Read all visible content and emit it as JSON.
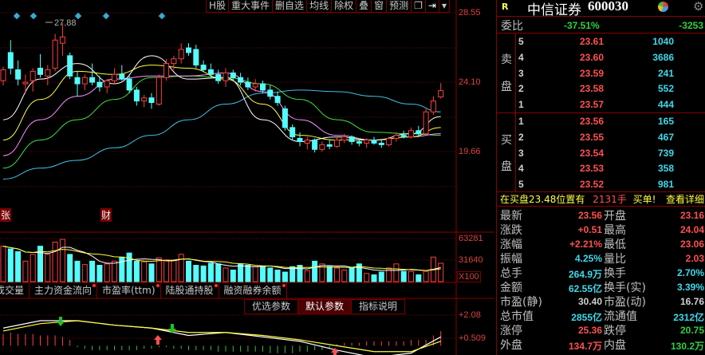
{
  "toolbar": {
    "items": [
      "H股",
      "重大事件",
      "删自选",
      "均线",
      "除权",
      "叠",
      "窗",
      "预测"
    ],
    "icons": [
      "window-icon",
      "export-icon",
      "dropdown-icon"
    ]
  },
  "price_axis": {
    "top": "28.55",
    "mid": "24.10",
    "low": "19.66"
  },
  "annotations": {
    "high_label": "27.88",
    "marker_zhang": "张",
    "marker_cai": "财"
  },
  "volume_axis": {
    "top": "63281",
    "mid": "31640",
    "unit": "X100"
  },
  "indicator_tabs": [
    {
      "label": "成交量"
    },
    {
      "label": "主力资金流向"
    },
    {
      "label": "市盈率(ttm)"
    },
    {
      "label": "陆股通持股"
    },
    {
      "label": "融资融券余额"
    }
  ],
  "param_buttons": {
    "optimized": "优选参数",
    "default": "默认参数",
    "explain": "指标说明"
  },
  "macd_axis": {
    "top": "+2.08",
    "mid": "+0.509"
  },
  "colors": {
    "up": "#ff4040",
    "down": "#54fcfc",
    "ma5": "#ffffff",
    "ma10": "#ffff40",
    "ma20": "#ff90ff",
    "ma30": "#40e040",
    "ma60": "#40c0e0"
  },
  "chart_data": {
    "type": "candlestick",
    "price_range": [
      19.66,
      28.55
    ],
    "candles": [
      [
        24.2,
        25.1,
        23.9,
        24.9
      ],
      [
        26.0,
        26.8,
        24.6,
        25.0
      ],
      [
        24.9,
        25.5,
        23.9,
        24.3
      ],
      [
        24.0,
        24.6,
        23.4,
        24.1
      ],
      [
        24.2,
        25.0,
        23.5,
        24.8
      ],
      [
        25.0,
        25.9,
        24.4,
        24.6
      ],
      [
        24.5,
        25.2,
        23.9,
        24.9
      ],
      [
        25.0,
        27.2,
        24.8,
        26.8
      ],
      [
        26.6,
        27.88,
        25.8,
        27.0
      ],
      [
        25.8,
        26.0,
        24.3,
        24.5
      ],
      [
        24.4,
        24.8,
        23.2,
        24.0
      ],
      [
        24.0,
        24.6,
        23.6,
        24.4
      ],
      [
        24.4,
        25.3,
        23.9,
        24.1
      ],
      [
        24.1,
        24.5,
        23.5,
        23.8
      ],
      [
        23.8,
        24.3,
        23.4,
        24.2
      ],
      [
        24.2,
        25.0,
        24.0,
        24.6
      ],
      [
        24.6,
        25.2,
        24.2,
        24.3
      ],
      [
        24.3,
        24.6,
        23.4,
        23.6
      ],
      [
        23.6,
        23.8,
        22.6,
        22.9
      ],
      [
        22.9,
        23.3,
        22.5,
        23.1
      ],
      [
        23.1,
        23.4,
        22.4,
        22.8
      ],
      [
        22.7,
        24.6,
        22.6,
        24.4
      ],
      [
        24.4,
        25.6,
        24.2,
        25.3
      ],
      [
        25.3,
        25.8,
        24.9,
        25.6
      ],
      [
        25.6,
        26.6,
        25.3,
        26.2
      ],
      [
        26.3,
        26.6,
        25.8,
        26.0
      ],
      [
        26.2,
        26.5,
        25.0,
        25.2
      ],
      [
        25.2,
        25.5,
        24.8,
        24.9
      ],
      [
        24.9,
        25.3,
        24.4,
        24.6
      ],
      [
        24.6,
        24.9,
        24.0,
        24.2
      ],
      [
        24.2,
        25.0,
        23.8,
        24.7
      ],
      [
        24.7,
        24.9,
        24.2,
        24.4
      ],
      [
        24.4,
        24.7,
        23.9,
        24.1
      ],
      [
        24.1,
        24.4,
        23.6,
        23.8
      ],
      [
        23.8,
        24.3,
        23.5,
        24.0
      ],
      [
        24.0,
        24.2,
        23.4,
        23.6
      ],
      [
        23.6,
        23.9,
        23.0,
        23.2
      ],
      [
        23.2,
        23.5,
        22.6,
        22.8
      ],
      [
        22.4,
        22.6,
        21.0,
        21.2
      ],
      [
        21.2,
        21.4,
        20.4,
        20.6
      ],
      [
        20.5,
        20.9,
        20.0,
        20.3
      ],
      [
        20.2,
        20.6,
        19.8,
        20.4
      ],
      [
        20.4,
        20.5,
        19.6,
        19.8
      ],
      [
        19.8,
        20.3,
        19.66,
        20.1
      ],
      [
        20.1,
        20.4,
        19.8,
        20.0
      ],
      [
        20.0,
        20.6,
        19.9,
        20.4
      ],
      [
        20.4,
        20.8,
        20.2,
        20.6
      ],
      [
        20.6,
        20.7,
        20.1,
        20.3
      ],
      [
        20.3,
        20.5,
        20.0,
        20.2
      ],
      [
        20.2,
        20.5,
        19.9,
        20.4
      ],
      [
        20.4,
        20.6,
        20.1,
        20.2
      ],
      [
        20.2,
        20.4,
        19.9,
        20.1
      ],
      [
        20.1,
        20.6,
        20.0,
        20.5
      ],
      [
        20.5,
        20.9,
        20.3,
        20.7
      ],
      [
        20.7,
        21.0,
        20.5,
        20.6
      ],
      [
        20.6,
        21.2,
        20.5,
        21.0
      ],
      [
        21.0,
        21.3,
        20.6,
        20.8
      ],
      [
        20.8,
        22.4,
        20.7,
        22.2
      ],
      [
        22.2,
        23.2,
        22.0,
        22.9
      ],
      [
        23.16,
        24.04,
        23.06,
        23.56
      ]
    ],
    "ma_sample_every": 5,
    "ma": {
      "ma5": [
        21.7,
        24.3,
        25.3,
        24.0,
        25.8,
        24.3,
        24.4,
        21.7,
        20.3,
        20.6,
        20.4,
        20.8,
        21.9
      ],
      "ma10": [
        20.4,
        23.0,
        24.8,
        24.6,
        25.2,
        25.0,
        24.3,
        22.7,
        20.7,
        20.4,
        20.4,
        20.6,
        21.2
      ],
      "ma20": [
        19.4,
        21.7,
        23.2,
        24.3,
        24.5,
        24.5,
        24.7,
        23.5,
        21.7,
        20.7,
        20.4,
        20.6,
        20.8
      ],
      "ma30": [
        18.6,
        20.4,
        21.7,
        23.0,
        24.4,
        24.5,
        24.4,
        24.0,
        23.0,
        21.7,
        20.9,
        20.8,
        20.7
      ],
      "ma60": [
        17.9,
        18.6,
        19.1,
        19.9,
        20.7,
        21.7,
        22.7,
        23.4,
        23.6,
        23.5,
        23.2,
        22.7,
        22.2
      ]
    },
    "volume": [
      52000,
      48000,
      44000,
      30000,
      40000,
      52000,
      40000,
      58000,
      62000,
      40000,
      30000,
      25000,
      30000,
      24000,
      26000,
      30000,
      36000,
      42000,
      30000,
      29000,
      26000,
      35000,
      32000,
      31000,
      40000,
      30000,
      24000,
      23000,
      27000,
      26000,
      20000,
      17000,
      26000,
      24000,
      22000,
      23000,
      20000,
      17000,
      14000,
      22000,
      24000,
      16000,
      30000,
      26000,
      22000,
      20000,
      17000,
      20000,
      26000,
      12000,
      10000,
      14000,
      20000,
      26000,
      15000,
      15000,
      10000,
      15000,
      36000,
      27000
    ],
    "volume_range": [
      0,
      63281
    ],
    "macd_hist": [
      0.8,
      0.9,
      0.8,
      0.8,
      0.8,
      0.7,
      0.7,
      0.7,
      0.6,
      0.4,
      -0.1,
      -0.2,
      -0.3,
      -0.3,
      -0.3,
      -0.3,
      -0.3,
      -0.3,
      -0.3,
      -0.2,
      -0.2,
      -0.1,
      -0.1,
      -0.2,
      -0.2,
      -0.3,
      -0.3,
      -0.3,
      -0.3,
      -0.4,
      -0.4,
      -0.4,
      -0.4,
      -0.4,
      -0.4,
      -0.4,
      -0.5,
      -0.5,
      -0.5,
      -0.5,
      -0.4,
      -0.4,
      -0.3,
      -0.3,
      -0.2,
      0.1,
      0.2,
      0.2,
      0.2,
      0.3,
      0.3,
      0.3,
      0.3,
      0.3,
      0.3,
      0.4,
      0.4,
      0.4,
      0.7,
      1.0
    ],
    "macd_sample_every": 5,
    "dif": [
      1.2,
      1.7,
      1.7,
      1.4,
      1.2,
      0.7,
      0.9,
      0.6,
      0.3,
      -0.3,
      -0.8,
      -0.5,
      0.6
    ],
    "dea": [
      1.0,
      1.5,
      1.7,
      1.4,
      1.2,
      0.9,
      0.9,
      0.7,
      0.4,
      0.0,
      -0.4,
      -0.4,
      0.3
    ],
    "macd_range": [
      0.509,
      2.08
    ]
  },
  "quote": {
    "badge": "R",
    "name": "中信证券",
    "code": "600030",
    "weibi": {
      "label": "委比",
      "pct": "-37.51%",
      "diff": "-3253"
    },
    "sell_label": [
      "卖",
      "盘"
    ],
    "buy_label": [
      "买",
      "盘"
    ],
    "asks": [
      {
        "lv": "5",
        "price": "23.61",
        "vol": "1040"
      },
      {
        "lv": "4",
        "price": "23.60",
        "vol": "3686"
      },
      {
        "lv": "3",
        "price": "23.59",
        "vol": "241"
      },
      {
        "lv": "2",
        "price": "23.58",
        "vol": "552"
      },
      {
        "lv": "1",
        "price": "23.57",
        "vol": "444"
      }
    ],
    "bids": [
      {
        "lv": "1",
        "price": "23.56",
        "vol": "165"
      },
      {
        "lv": "2",
        "price": "23.55",
        "vol": "467"
      },
      {
        "lv": "3",
        "price": "23.54",
        "vol": "739"
      },
      {
        "lv": "4",
        "price": "23.53",
        "vol": "358"
      },
      {
        "lv": "5",
        "price": "23.52",
        "vol": "981"
      }
    ],
    "notice": {
      "text": "在买盘23.48位置有",
      "qty": "2131手",
      "tail": "买单!",
      "link": "查看详细"
    },
    "stats": [
      {
        "l1": "最新",
        "v1": "23.56",
        "c1": "red",
        "l2": "开盘",
        "v2": "23.16",
        "c2": "red"
      },
      {
        "l1": "涨跌",
        "v1": "+0.51",
        "c1": "red",
        "l2": "最高",
        "v2": "24.04",
        "c2": "red"
      },
      {
        "l1": "涨幅",
        "v1": "+2.21%",
        "c1": "red",
        "l2": "最低",
        "v2": "23.06",
        "c2": "red"
      },
      {
        "l1": "振幅",
        "v1": "4.25%",
        "c1": "cy",
        "l2": "量比",
        "v2": "2.03",
        "c2": "red"
      },
      {
        "l1": "总手",
        "v1": "264.9万",
        "c1": "cy",
        "l2": "换手",
        "v2": "2.70%",
        "c2": "cy"
      },
      {
        "l1": "金额",
        "v1": "62.55亿",
        "c1": "cy",
        "l2": "换手(实)",
        "v2": "3.39%",
        "c2": "cy"
      },
      {
        "l1": "市盈(静)",
        "v1": "30.40",
        "c1": "wh",
        "l2": "市盈(动)",
        "v2": "16.76",
        "c2": "wh"
      },
      {
        "l1": "总市值",
        "v1": "2855亿",
        "c1": "cy",
        "l2": "流通值",
        "v2": "2312亿",
        "c2": "cy"
      },
      {
        "l1": "涨停",
        "v1": "25.36",
        "c1": "red",
        "l2": "跌停",
        "v2": "20.75",
        "c2": "gr"
      },
      {
        "l1": "外盘",
        "v1": "134.7万",
        "c1": "red",
        "l2": "内盘",
        "v2": "130.2万",
        "c2": "gr"
      }
    ]
  }
}
